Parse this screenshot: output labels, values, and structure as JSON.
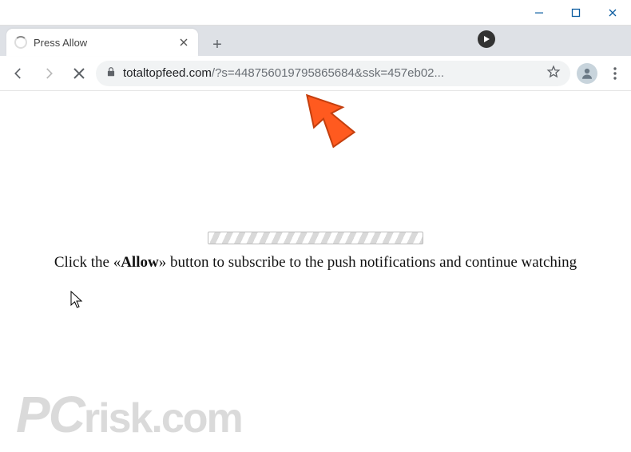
{
  "window": {
    "minimize": "—",
    "maximize": "□",
    "close": "✕"
  },
  "tab": {
    "title": "Press Allow",
    "close": "✕"
  },
  "newtab": "+",
  "toolbar": {
    "url_domain": "totaltopfeed.com",
    "url_rest": "/?s=44875601979586568­4&ssk=457eb02..."
  },
  "page": {
    "msg_pre": "Click the «",
    "msg_bold": "Allow",
    "msg_post": "» button to subscribe to the push notifications and continue watching"
  },
  "watermark": {
    "brand_pc": "PC",
    "brand_rest": "risk.com"
  }
}
